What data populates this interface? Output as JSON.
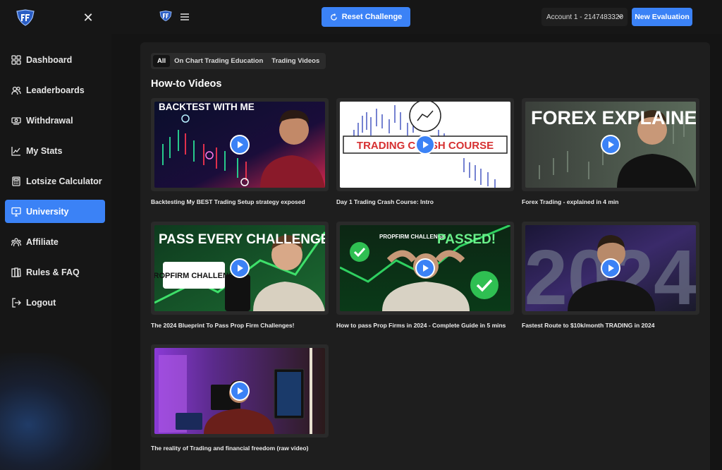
{
  "sidebar": {
    "items": [
      {
        "label": "Dashboard",
        "icon": "grid-icon"
      },
      {
        "label": "Leaderboards",
        "icon": "users-icon"
      },
      {
        "label": "Withdrawal",
        "icon": "money-icon"
      },
      {
        "label": "My Stats",
        "icon": "chart-icon"
      },
      {
        "label": "Lotsize Calculator",
        "icon": "calculator-icon"
      },
      {
        "label": "University",
        "icon": "monitor-icon",
        "active": true
      },
      {
        "label": "Affiliate",
        "icon": "network-icon"
      },
      {
        "label": "Rules & FAQ",
        "icon": "book-icon"
      },
      {
        "label": "Logout",
        "icon": "logout-icon"
      }
    ]
  },
  "topbar": {
    "reset_label": "Reset Challenge",
    "account_label": "Account 1 - 2147483320",
    "new_evaluation_label": "New Evaluation"
  },
  "filters": {
    "tabs": [
      "All",
      "On Chart Trading Education",
      "Trading Videos"
    ],
    "active": "All"
  },
  "section_title": "How-to Videos",
  "videos": [
    {
      "title": "Backtesting My BEST Trading Setup strategy exposed",
      "thumb_text": "BACKTEST WITH ME"
    },
    {
      "title": "Day 1 Trading Crash Course: Intro",
      "thumb_text": "TRADING CRASH COURSE"
    },
    {
      "title": "Forex Trading - explained in 4 min",
      "thumb_text": "FOREX EXPLAINED"
    },
    {
      "title": "The 2024 Blueprint To Pass Prop Firm Challenges!",
      "thumb_text": "PASS EVERY CHALLENGE",
      "thumb_sub": "PROPFIRM CHALLENGE"
    },
    {
      "title": "How to pass Prop Firms in 2024 - Complete Guide in 5 mins",
      "thumb_text": "PASSED!",
      "thumb_sub": "PROPFIRM CHALLENGE"
    },
    {
      "title": "Fastest Route to $10k/month TRADING in 2024",
      "thumb_text": "2024"
    },
    {
      "title": "The reality of Trading and financial freedom (raw video)",
      "thumb_text": ""
    }
  ],
  "colors": {
    "accent": "#3b82f6",
    "background": "#141414",
    "panel": "#1e1e1e",
    "sidebar": "#161616"
  }
}
